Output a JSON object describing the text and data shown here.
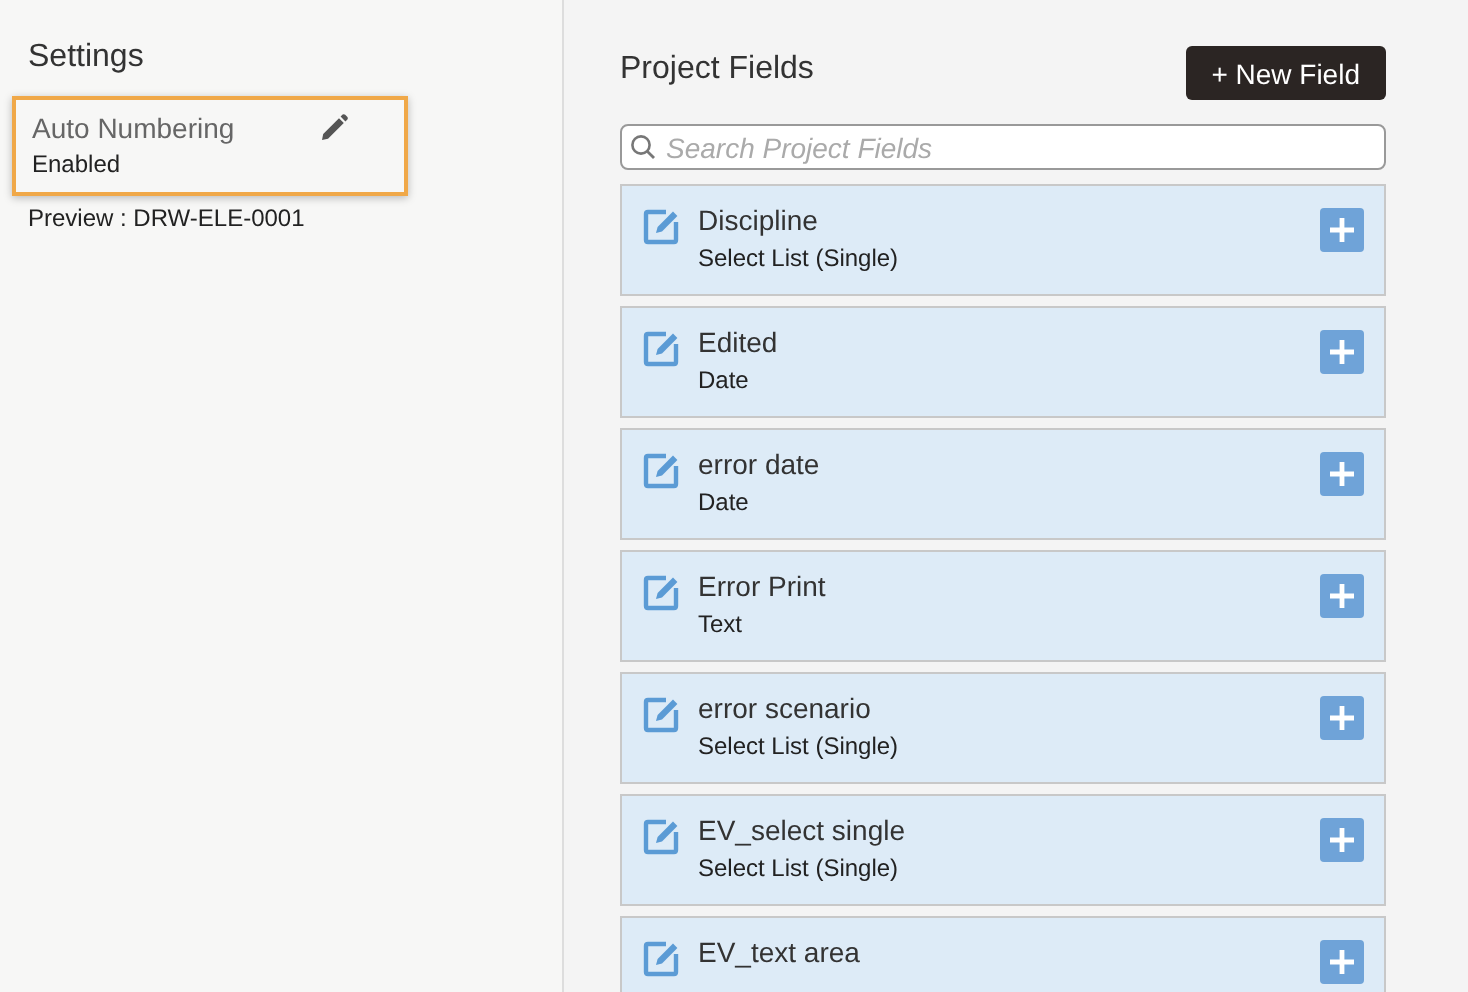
{
  "settings": {
    "title": "Settings",
    "auto_numbering": {
      "label": "Auto Numbering",
      "status": "Enabled",
      "highlighted": true
    },
    "preview": "Preview : DRW-ELE-0001"
  },
  "project_fields": {
    "title": "Project Fields",
    "new_button": "+ New Field",
    "search": {
      "placeholder": "Search Project Fields"
    },
    "fields": [
      {
        "name": "Discipline",
        "type": "Select List (Single)"
      },
      {
        "name": "Edited",
        "type": "Date"
      },
      {
        "name": "error date",
        "type": "Date"
      },
      {
        "name": "Error Print",
        "type": "Text"
      },
      {
        "name": "error scenario",
        "type": "Select List (Single)"
      },
      {
        "name": "EV_select single",
        "type": "Select List (Single)"
      },
      {
        "name": "EV_text area"
      }
    ]
  }
}
